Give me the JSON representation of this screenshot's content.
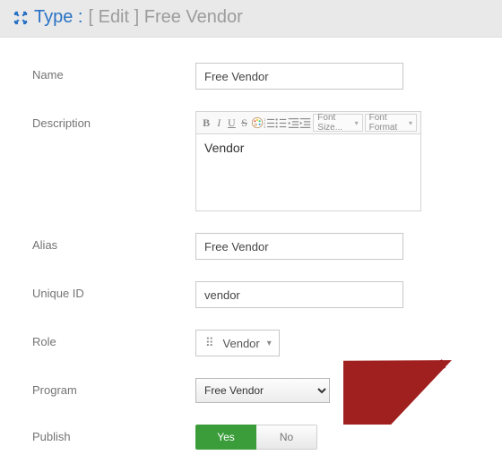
{
  "header": {
    "type_label": "Type :",
    "title": "[ Edit ] Free Vendor"
  },
  "form": {
    "name": {
      "label": "Name",
      "value": "Free Vendor"
    },
    "description": {
      "label": "Description",
      "value": "Vendor",
      "toolbar": {
        "bold": "B",
        "italic": "I",
        "underline": "U",
        "strike": "S",
        "font_size": "Font Size...",
        "font_format": "Font Format"
      }
    },
    "alias": {
      "label": "Alias",
      "value": "Free Vendor"
    },
    "uniqueid": {
      "label": "Unique ID",
      "value": "vendor"
    },
    "role": {
      "label": "Role",
      "value": "Vendor"
    },
    "program": {
      "label": "Program",
      "value": "Free Vendor"
    },
    "publish": {
      "label": "Publish",
      "yes": "Yes",
      "no": "No"
    }
  }
}
